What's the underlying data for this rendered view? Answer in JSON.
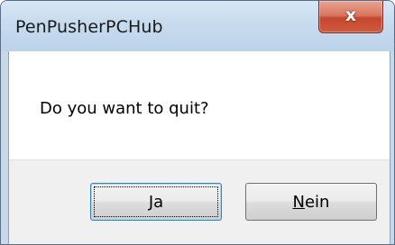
{
  "window": {
    "title": "PenPusherPCHub",
    "close_icon": "close-icon",
    "close_glyph": "x"
  },
  "dialog": {
    "message": "Do you want to quit?"
  },
  "buttons": {
    "yes": {
      "mnemonic": "J",
      "rest": "a"
    },
    "no": {
      "mnemonic": "N",
      "rest": "ein"
    }
  },
  "colors": {
    "titlebar": "#c7dbee",
    "close_button": "#c4472f",
    "button_area": "#f0f0f0"
  }
}
